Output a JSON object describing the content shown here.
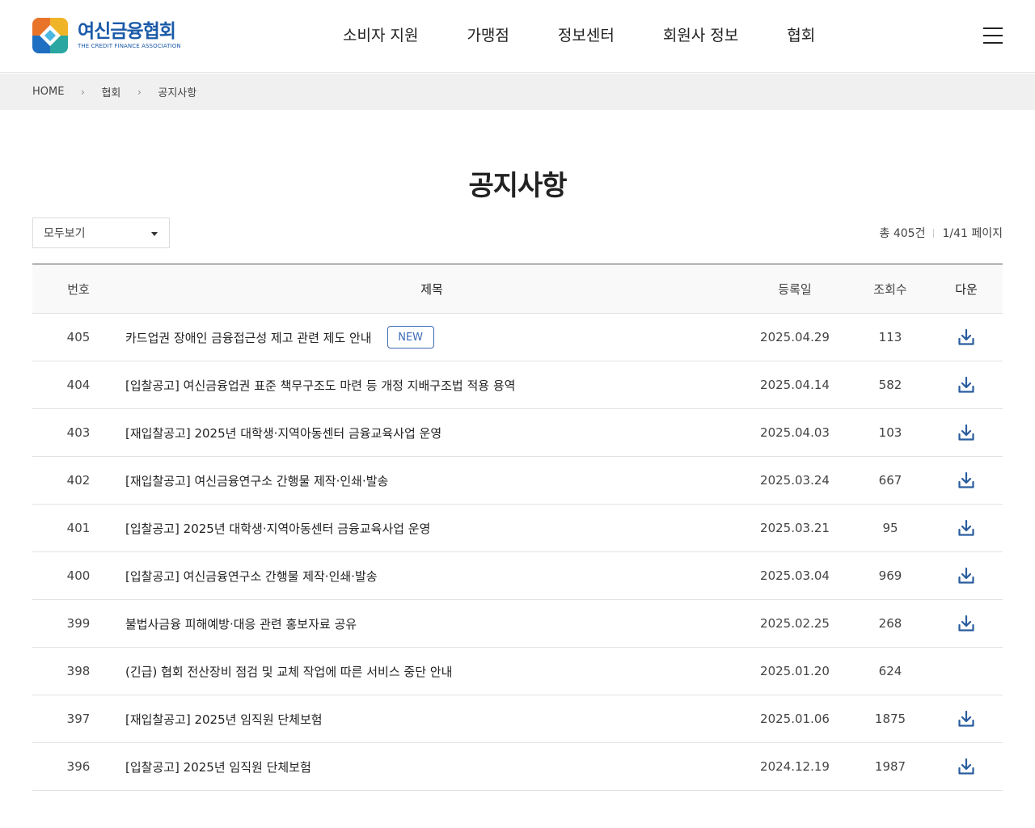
{
  "header": {
    "logo_ko": "여신금융협회",
    "logo_en": "THE CREDIT FINANCE ASSOCIATION",
    "nav": [
      "소비자 지원",
      "가맹점",
      "정보센터",
      "회원사 정보",
      "협회"
    ],
    "menu_icon": "hamburger-icon"
  },
  "breadcrumb": {
    "items": [
      "HOME",
      "협회",
      "공지사항"
    ],
    "separator": "›"
  },
  "page": {
    "title": "공지사항",
    "filter_value": "모두보기",
    "total_label": "총 405건",
    "page_label": "1/41 페이지"
  },
  "table": {
    "headers": {
      "no": "번호",
      "title": "제목",
      "date": "등록일",
      "views": "조회수",
      "download": "다운"
    },
    "new_badge": "NEW",
    "rows": [
      {
        "no": "405",
        "title": "카드업권 장애인 금융접근성 제고 관련 제도 안내",
        "date": "2025.04.29",
        "views": "113",
        "is_new": true,
        "has_file": true
      },
      {
        "no": "404",
        "title": "[입찰공고] 여신금융업권 표준 책무구조도 마련 등 개정 지배구조법 적용 용역",
        "date": "2025.04.14",
        "views": "582",
        "is_new": false,
        "has_file": true
      },
      {
        "no": "403",
        "title": "[재입찰공고] 2025년 대학생·지역아동센터 금융교육사업 운영",
        "date": "2025.04.03",
        "views": "103",
        "is_new": false,
        "has_file": true
      },
      {
        "no": "402",
        "title": "[재입찰공고] 여신금융연구소 간행물 제작·인쇄·발송",
        "date": "2025.03.24",
        "views": "667",
        "is_new": false,
        "has_file": true
      },
      {
        "no": "401",
        "title": "[입찰공고] 2025년 대학생·지역아동센터 금융교육사업 운영",
        "date": "2025.03.21",
        "views": "95",
        "is_new": false,
        "has_file": true
      },
      {
        "no": "400",
        "title": "[입찰공고] 여신금융연구소 간행물 제작·인쇄·발송",
        "date": "2025.03.04",
        "views": "969",
        "is_new": false,
        "has_file": true
      },
      {
        "no": "399",
        "title": "불법사금융 피해예방·대응 관련 홍보자료 공유",
        "date": "2025.02.25",
        "views": "268",
        "is_new": false,
        "has_file": true
      },
      {
        "no": "398",
        "title": "(긴급) 협회 전산장비 점검 및 교체 작업에 따른 서비스 중단 안내",
        "date": "2025.01.20",
        "views": "624",
        "is_new": false,
        "has_file": false
      },
      {
        "no": "397",
        "title": "[재입찰공고] 2025년 임직원 단체보험",
        "date": "2025.01.06",
        "views": "1875",
        "is_new": false,
        "has_file": true
      },
      {
        "no": "396",
        "title": "[입찰공고] 2025년 임직원 단체보험",
        "date": "2024.12.19",
        "views": "1987",
        "is_new": false,
        "has_file": true
      }
    ]
  },
  "colors": {
    "brand": "#1a5aa8",
    "accent": "#3b6bb5",
    "download_icon": "#2a5d9f"
  }
}
